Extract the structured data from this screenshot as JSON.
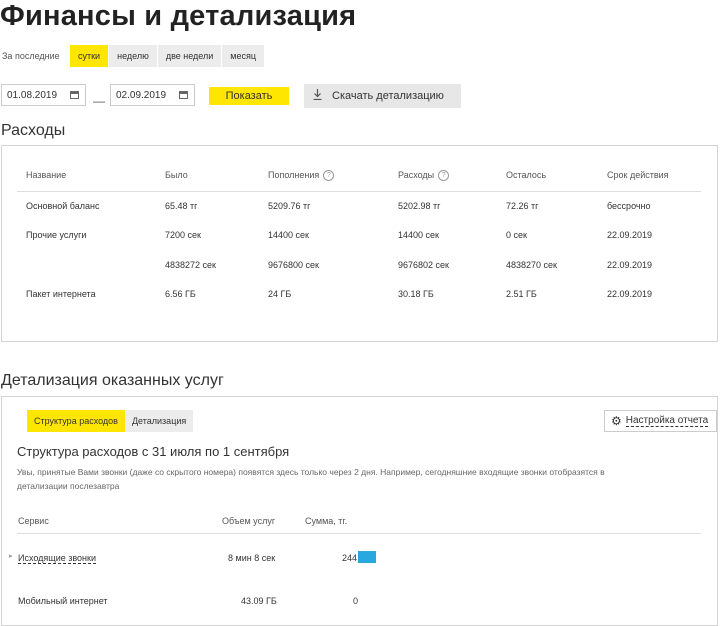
{
  "page": {
    "title": "Финансы и детализация"
  },
  "period": {
    "label": "За последние",
    "options": [
      "сутки",
      "неделю",
      "две недели",
      "месяц"
    ],
    "active_index": 0
  },
  "dates": {
    "from": "01.08.2019",
    "separator": "—",
    "to": "02.09.2019"
  },
  "actions": {
    "show_label": "Показать",
    "download_label": "Скачать детализацию"
  },
  "expenses": {
    "heading": "Расходы",
    "columns": [
      "Название",
      "Было",
      "Пополнения",
      "Расходы",
      "Осталось",
      "Срок действия"
    ],
    "rows": [
      [
        "Основной баланс",
        "65.48 тг",
        "5209.76 тг",
        "5202.98 тг",
        "72.26 тг",
        "бессрочно"
      ],
      [
        "Прочие услуги",
        "7200 сек",
        "14400 сек",
        "14400 сек",
        "0 сек",
        "22.09.2019"
      ],
      [
        "",
        "4838272 сек",
        "9676800 сек",
        "9676802 сек",
        "4838270 сек",
        "22.09.2019"
      ],
      [
        "Пакет интернета",
        "6.56 ГБ",
        "24 ГБ",
        "30.18 ГБ",
        "2.51 ГБ",
        "22.09.2019"
      ]
    ]
  },
  "details": {
    "heading": "Детализация оказанных услуг",
    "tabs": [
      "Структура расходов",
      "Детализация"
    ],
    "settings_label": "Настройка отчета",
    "subheading": "Структура расходов с 31 июля по 1 сентября",
    "note_line1": "Увы, принятые Вами звонки (даже со скрытого номера) появятся здесь только через 2 дня. Например, сегодняшние входящие звонки отобразятся в",
    "note_line2": "детализации послезавтра",
    "columns": [
      "Сервис",
      "Объем услуг",
      "Сумма, тг."
    ],
    "rows": [
      {
        "service": "Исходящие звонки",
        "volume": "8 мин 8 сек",
        "sum": "244"
      },
      {
        "service": "Мобильный интернет",
        "volume": "43.09 ГБ",
        "sum": "0"
      }
    ],
    "bar_color": "#29a8e0"
  },
  "colors": {
    "accent": "#ffe600"
  }
}
